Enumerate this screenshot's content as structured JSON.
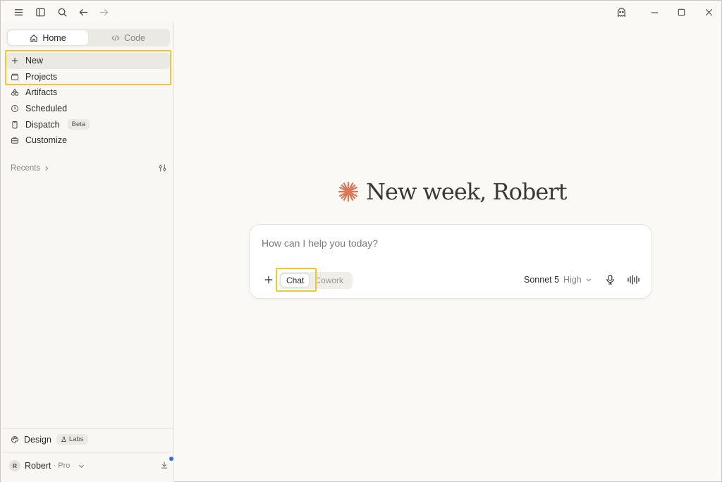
{
  "titlebar": {
    "icons": [
      "menu-icon",
      "sidebar-toggle-icon",
      "search-icon",
      "back-arrow-icon",
      "forward-arrow-icon",
      "ghost-icon",
      "minimize-icon",
      "maximize-icon",
      "close-icon"
    ]
  },
  "sidebar": {
    "tabs": [
      {
        "label": "Home",
        "icon": "home-icon",
        "active": true
      },
      {
        "label": "Code",
        "icon": "code-icon",
        "active": false
      }
    ],
    "nav": [
      {
        "label": "New",
        "icon": "plus-icon"
      },
      {
        "label": "Projects",
        "icon": "folder-icon"
      },
      {
        "label": "Artifacts",
        "icon": "shapes-icon"
      },
      {
        "label": "Scheduled",
        "icon": "clock-icon"
      },
      {
        "label": "Dispatch",
        "icon": "phone-icon",
        "badge": "Beta"
      },
      {
        "label": "Customize",
        "icon": "briefcase-icon"
      }
    ],
    "recents_label": "Recents",
    "design": {
      "label": "Design",
      "badge": "Labs"
    },
    "user": {
      "initial": "R",
      "name": "Robert",
      "plan": "· Pro"
    }
  },
  "main": {
    "greeting": "New week, Robert",
    "composer": {
      "placeholder": "How can I help you today?",
      "modes": [
        "Chat",
        "Cowork"
      ],
      "active_mode": "Chat",
      "model": "Sonnet 5",
      "effort": "High"
    }
  },
  "colors": {
    "accent": "#d97757",
    "highlight": "#f2c631",
    "background": "#faf9f5"
  }
}
